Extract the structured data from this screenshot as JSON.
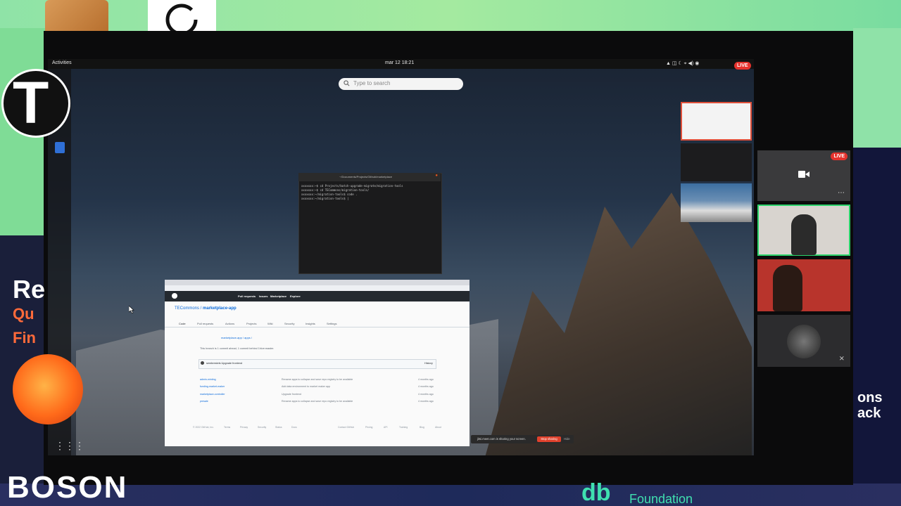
{
  "topbar": {
    "activities": "Activities",
    "clock": "mar 12  18:21",
    "live_badge": "LIVE"
  },
  "search": {
    "placeholder": "Type to search"
  },
  "terminal": {
    "title": "~/Documents/Projects/Github/marketplace",
    "lines": [
      "xxxxxxx:~$ cd Projects/batch-upgrade-migrate/migration-tools",
      "xxxxxxx:~$ cd TECommons/migration-tools/",
      "xxxxxxx:~/migration-tools$ code .",
      "xxxxxxx:~/migration-tools$ |"
    ]
  },
  "browser": {
    "nav": [
      "Pull requests",
      "Issues",
      "Marketplace",
      "Explore"
    ],
    "repo_owner": "TECommons",
    "repo_name": "marketplace-app",
    "repo_tabs": [
      "Code",
      "Pull requests",
      "Actions",
      "Projects",
      "Wiki",
      "Security",
      "Insights",
      "Settings"
    ],
    "branch_path": "marketplace-app / apps /",
    "commit_notice": "This branch is 1 commit ahead, 1 commit behind 1hive:master.",
    "commit_author": "sembrestels  Upgrade frontend",
    "history": "History",
    "files": [
      {
        "name": "admin-minting",
        "message": "Rename apps to collapse and save repo registry to be available",
        "date": "4 months ago"
      },
      {
        "name": "funding-market-maker",
        "message": "Add data environment to market maker app",
        "date": "4 months ago"
      },
      {
        "name": "marketplace-controller",
        "message": "Upgrade frontend",
        "date": "4 months ago"
      },
      {
        "name": "presale",
        "message": "Rename apps to collapse and save repo registry to be available",
        "date": "4 months ago"
      }
    ],
    "footer": [
      "© 2022 GitHub, Inc.",
      "Terms",
      "Privacy",
      "Security",
      "Status",
      "Docs",
      "Contact GitHub",
      "Pricing",
      "API",
      "Training",
      "Blog",
      "About"
    ]
  },
  "sharebar": {
    "text": "jitsi.meet.com is sharing your screen.",
    "stop": "Stop sharing",
    "hide": "Hide"
  },
  "participants": {
    "live_badge": "LIVE"
  },
  "overlay": {
    "brand_bottom": "BOSON",
    "foundation": "Foundation",
    "left_text_1": "Re",
    "left_text_2": "Qu",
    "left_text_3": "Fin",
    "right_text_1": "ons",
    "right_text_2": "ack"
  },
  "colors": {
    "accent_red": "#e5322d",
    "active_speaker": "#2bd46b",
    "github_header": "#24292f",
    "link_blue": "#0969da"
  }
}
